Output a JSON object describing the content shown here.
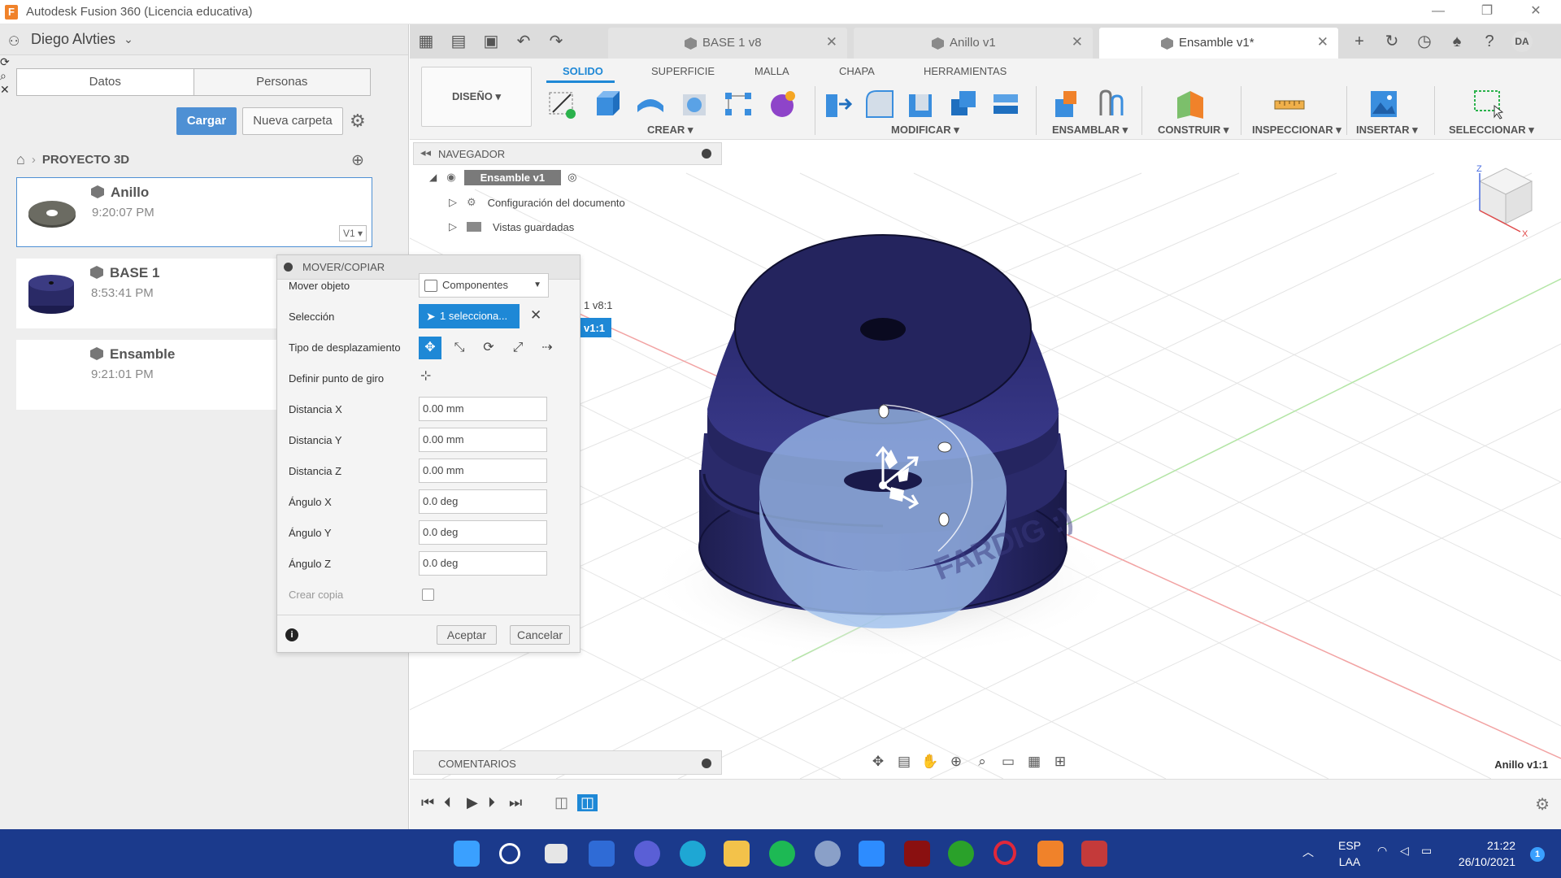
{
  "window": {
    "title": "Autodesk Fusion 360 (Licencia educativa)",
    "minimize": "—",
    "restore": "❐",
    "close": "✕"
  },
  "data_panel": {
    "user_name": "Diego Alvties",
    "tabs": [
      "Datos",
      "Personas"
    ],
    "upload_label": "Cargar",
    "new_folder_label": "Nueva carpeta",
    "breadcrumb_project": "PROYECTO 3D",
    "files": [
      {
        "name": "Anillo",
        "time": "9:20:07 PM",
        "version": "V1 ▾"
      },
      {
        "name": "BASE 1",
        "time": "8:53:41 PM"
      },
      {
        "name": "Ensamble",
        "time": "9:21:01 PM"
      }
    ]
  },
  "doc_tabs": [
    {
      "label": "BASE 1 v8",
      "active": false
    },
    {
      "label": "Anillo v1",
      "active": false
    },
    {
      "label": "Ensamble v1*",
      "active": true
    }
  ],
  "user_initials": "DA",
  "ribbon": {
    "workspace": "DISEÑO ▾",
    "tabs": [
      "SOLIDO",
      "SUPERFICIE",
      "MALLA",
      "CHAPA",
      "HERRAMIENTAS"
    ],
    "active_tab": "SOLIDO",
    "groups": [
      "CREAR ▾",
      "MODIFICAR ▾",
      "ENSAMBLAR ▾",
      "CONSTRUIR ▾",
      "INSPECCIONAR ▾",
      "INSERTAR ▾",
      "SELECCIONAR ▾"
    ]
  },
  "navigator": {
    "title": "NAVEGADOR",
    "root": "Ensamble v1",
    "items": [
      "Configuración del documento",
      "Vistas guardadas"
    ],
    "partial_items": [
      "1 v8:1",
      "v1:1"
    ]
  },
  "move_copy_dialog": {
    "title": "MOVER/COPIAR",
    "move_object_label": "Mover objeto",
    "move_object_value": "Componentes",
    "selection_label": "Selección",
    "selection_value": "1 selecciona...",
    "move_type_label": "Tipo de desplazamiento",
    "pivot_label": "Definir punto de giro",
    "fields": [
      {
        "label": "Distancia X",
        "value": "0.00 mm"
      },
      {
        "label": "Distancia Y",
        "value": "0.00 mm"
      },
      {
        "label": "Distancia Z",
        "value": "0.00 mm"
      },
      {
        "label": "Ángulo X",
        "value": "0.0 deg"
      },
      {
        "label": "Ángulo Y",
        "value": "0.0 deg"
      },
      {
        "label": "Ángulo Z",
        "value": "0.0 deg"
      }
    ],
    "create_copy_label": "Crear copia",
    "ok_label": "Aceptar",
    "cancel_label": "Cancelar"
  },
  "comments_label": "COMENTARIOS",
  "active_component": "Anillo v1:1",
  "model_text": "FARDIG :)",
  "taskbar": {
    "language": "ESP",
    "region": "LAA",
    "time": "21:22",
    "date": "26/10/2021",
    "notifications": "1"
  },
  "colors": {
    "accent": "#1e88d6",
    "model": "#2f2f78",
    "selection_overlay": "#9fc0ee",
    "taskbar": "#1b3a8c"
  }
}
